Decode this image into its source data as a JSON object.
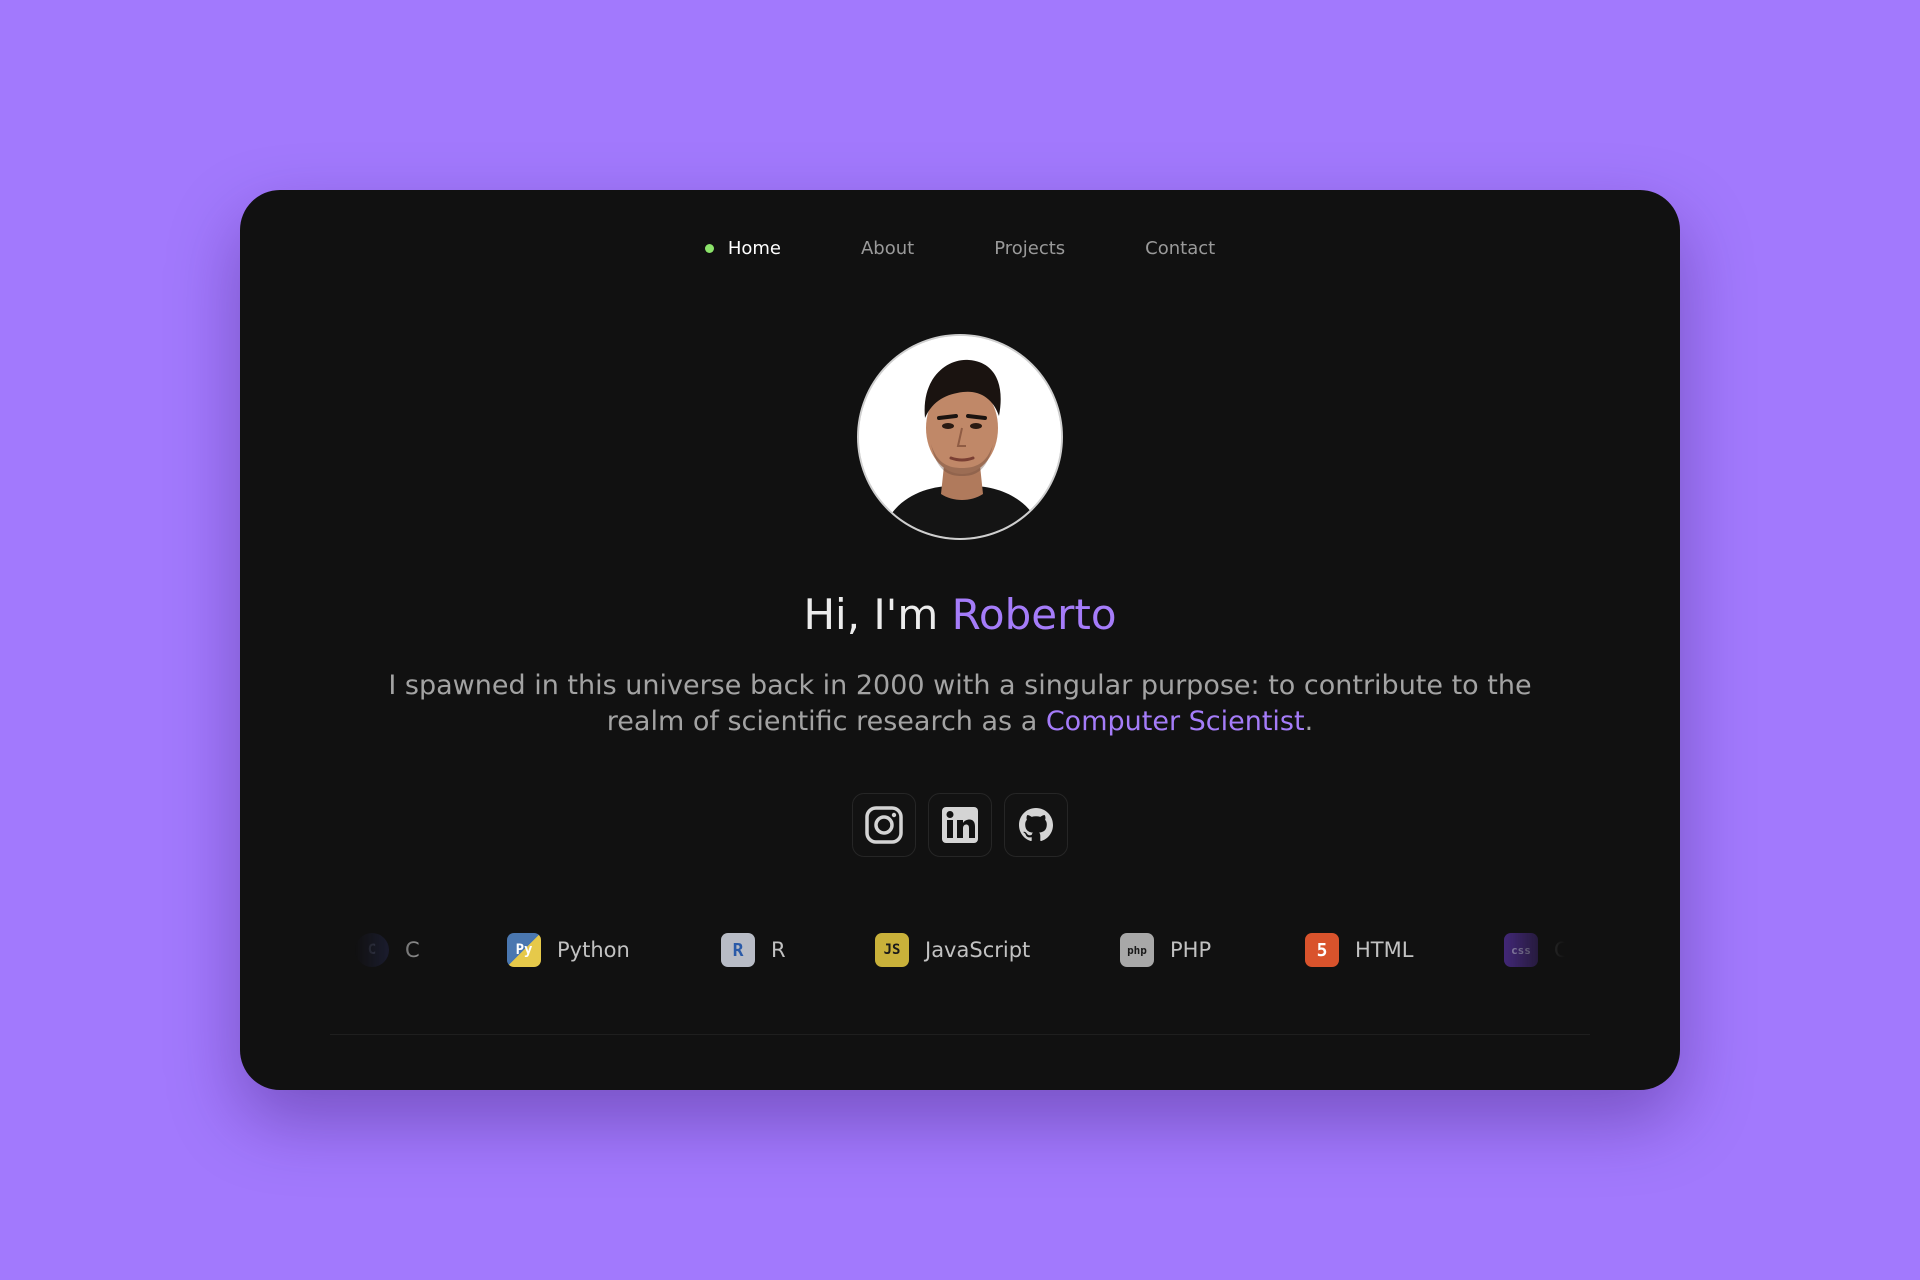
{
  "nav": {
    "items": [
      {
        "label": "Home",
        "active": true
      },
      {
        "label": "About",
        "active": false
      },
      {
        "label": "Projects",
        "active": false
      },
      {
        "label": "Contact",
        "active": false
      }
    ]
  },
  "hero": {
    "greeting": "Hi, I'm ",
    "name": "Roberto",
    "description_prefix": "I spawned in this universe back in 2000 with a singular purpose: to contribute to the realm of scientific research as a ",
    "description_highlight": "Computer Scientist",
    "description_suffix": "."
  },
  "socials": [
    {
      "icon": "instagram-icon"
    },
    {
      "icon": "linkedin-icon"
    },
    {
      "icon": "github-icon"
    }
  ],
  "skills": [
    {
      "label": "C",
      "icon": "c-icon",
      "icon_text": "C",
      "color": "#2b2f5e"
    },
    {
      "label": "Python",
      "icon": "python-icon",
      "icon_text": "Py",
      "color": "#4a77b0"
    },
    {
      "label": "R",
      "icon": "r-icon",
      "icon_text": "R",
      "color": "#6b7ea8"
    },
    {
      "label": "JavaScript",
      "icon": "javascript-icon",
      "icon_text": "JS",
      "color": "#c9b13a"
    },
    {
      "label": "PHP",
      "icon": "php-icon",
      "icon_text": "php",
      "color": "#8e8e8e"
    },
    {
      "label": "HTML",
      "icon": "html5-icon",
      "icon_text": "5",
      "color": "#d9532c"
    },
    {
      "label": "CSS",
      "icon": "css-icon",
      "icon_text": "css",
      "color": "#5a33a8"
    }
  ],
  "colors": {
    "background": "#a279fd",
    "card": "#111111",
    "accent": "#a57cf9",
    "active_dot": "#8be36a"
  }
}
